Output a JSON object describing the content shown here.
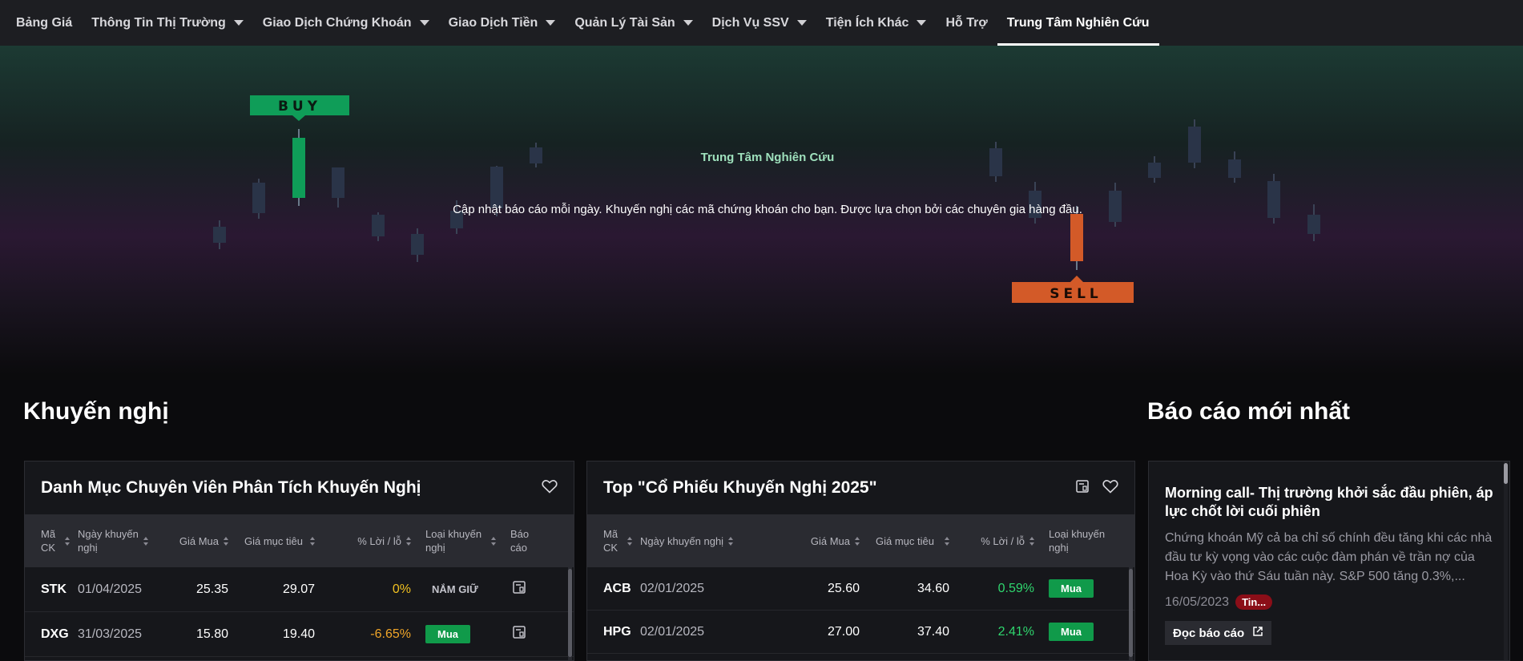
{
  "nav": {
    "items": [
      {
        "label": "Bảng Giá",
        "dropdown": false
      },
      {
        "label": "Thông Tin Thị Trường",
        "dropdown": true
      },
      {
        "label": "Giao Dịch Chứng Khoán",
        "dropdown": true
      },
      {
        "label": "Giao Dịch Tiền",
        "dropdown": true
      },
      {
        "label": "Quản Lý Tài Sản",
        "dropdown": true
      },
      {
        "label": "Dịch Vụ SSV",
        "dropdown": true
      },
      {
        "label": "Tiện Ích Khác",
        "dropdown": true
      },
      {
        "label": "Hỗ Trợ",
        "dropdown": false
      },
      {
        "label": "Trung Tâm Nghiên Cứu",
        "dropdown": false,
        "active": true
      }
    ]
  },
  "hero": {
    "title": "Trung Tâm Nghiên Cứu",
    "subtitle": "Cập nhật báo cáo mỗi ngày. Khuyến nghị các mã chứng khoán cho bạn. Được lựa chọn bởi các chuyên gia hàng đầu.",
    "buy_label": "BUY",
    "sell_label": "SELL",
    "colors": {
      "buy": "#0f9d58",
      "sell": "#d35a28",
      "candle": "#2a3448"
    }
  },
  "sections": {
    "recommendations": "Khuyến nghị",
    "latest_reports": "Báo cáo mới nhất"
  },
  "analyst_table": {
    "title": "Danh Mục Chuyên Viên Phân Tích Khuyến Nghị",
    "headers": {
      "symbol": "Mã CK",
      "date": "Ngày khuyến nghị",
      "buy_price": "Giá Mua",
      "target": "Giá mục tiêu",
      "pnl": "% Lời / lỗ",
      "type": "Loại khuyến nghị",
      "report": "Báo cáo"
    },
    "rows": [
      {
        "symbol": "STK",
        "date": "01/04/2025",
        "buy_price": "25.35",
        "target": "29.07",
        "pnl": "0%",
        "pnl_state": "zero",
        "type": "NẮM GIỮ",
        "type_style": "hold"
      },
      {
        "symbol": "DXG",
        "date": "31/03/2025",
        "buy_price": "15.80",
        "target": "19.40",
        "pnl": "-6.65%",
        "pnl_state": "neg",
        "type": "Mua",
        "type_style": "buy"
      }
    ]
  },
  "top_table": {
    "title": "Top \"Cổ Phiếu Khuyến Nghị 2025\"",
    "headers": {
      "symbol": "Mã CK",
      "date": "Ngày khuyến nghị",
      "buy_price": "Giá Mua",
      "target": "Giá mục tiêu",
      "pnl": "% Lời / lỗ",
      "type": "Loại khuyến nghị"
    },
    "rows": [
      {
        "symbol": "ACB",
        "date": "02/01/2025",
        "buy_price": "25.60",
        "target": "34.60",
        "pnl": "0.59%",
        "pnl_state": "pos",
        "type": "Mua",
        "type_style": "buy"
      },
      {
        "symbol": "HPG",
        "date": "02/01/2025",
        "buy_price": "27.00",
        "target": "37.40",
        "pnl": "2.41%",
        "pnl_state": "pos",
        "type": "Mua",
        "type_style": "buy"
      }
    ]
  },
  "news": {
    "title": "Morning call- Thị trường khởi sắc đầu phiên, áp lực chốt lời cuối phiên",
    "body": "Chứng khoán Mỹ cả ba chỉ số chính đều tăng khi các nhà đầu tư kỳ vọng vào các cuộc đàm phán về trần nợ của Hoa Kỳ vào thứ Sáu tuần này. S&P 500 tăng 0.3%,...",
    "date": "16/05/2023",
    "tag": "Tin...",
    "read_label": "Đọc báo cáo"
  }
}
